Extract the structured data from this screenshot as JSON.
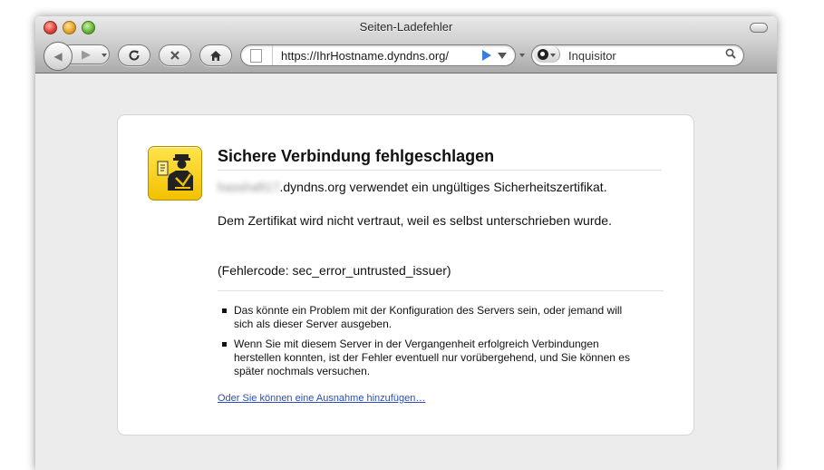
{
  "window": {
    "title": "Seiten-Ladefehler"
  },
  "toolbar": {
    "url": "https://IhrHostname.dyndns.org/",
    "search_placeholder": "Inquisitor"
  },
  "icons": {
    "back": "back-arrow-icon",
    "forward": "forward-arrow-icon",
    "reload": "reload-icon",
    "stop": "stop-icon",
    "home": "home-icon",
    "go": "go-arrow-icon",
    "search": "magnifier-icon",
    "certificate": "certificate-officer-icon"
  },
  "error": {
    "heading": "Sichere Verbindung fehlgeschlagen",
    "host_blurred": "hasshaft17",
    "host_suffix": ".dyndns.org verwendet ein ungültiges Sicherheitszertifikat.",
    "reason": "Dem Zertifikat wird nicht vertraut, weil es selbst unterschrieben wurde.",
    "code": "(Fehlercode: sec_error_untrusted_issuer)",
    "bullets": [
      "Das könnte ein Problem mit der Konfiguration des Servers sein, oder jemand will sich als dieser Server ausgeben.",
      "Wenn Sie mit diesem Server in der Vergangenheit erfolgreich Verbindungen herstellen konnten, ist der Fehler eventuell nur vorübergehend, und Sie können es später nochmals versuchen."
    ],
    "exception_link": "Oder Sie können eine Ausnahme hinzufügen…"
  },
  "colors": {
    "accent_link": "#2a4fb6",
    "icon_yellow": "#f2c100",
    "go_arrow": "#3b7be0"
  }
}
